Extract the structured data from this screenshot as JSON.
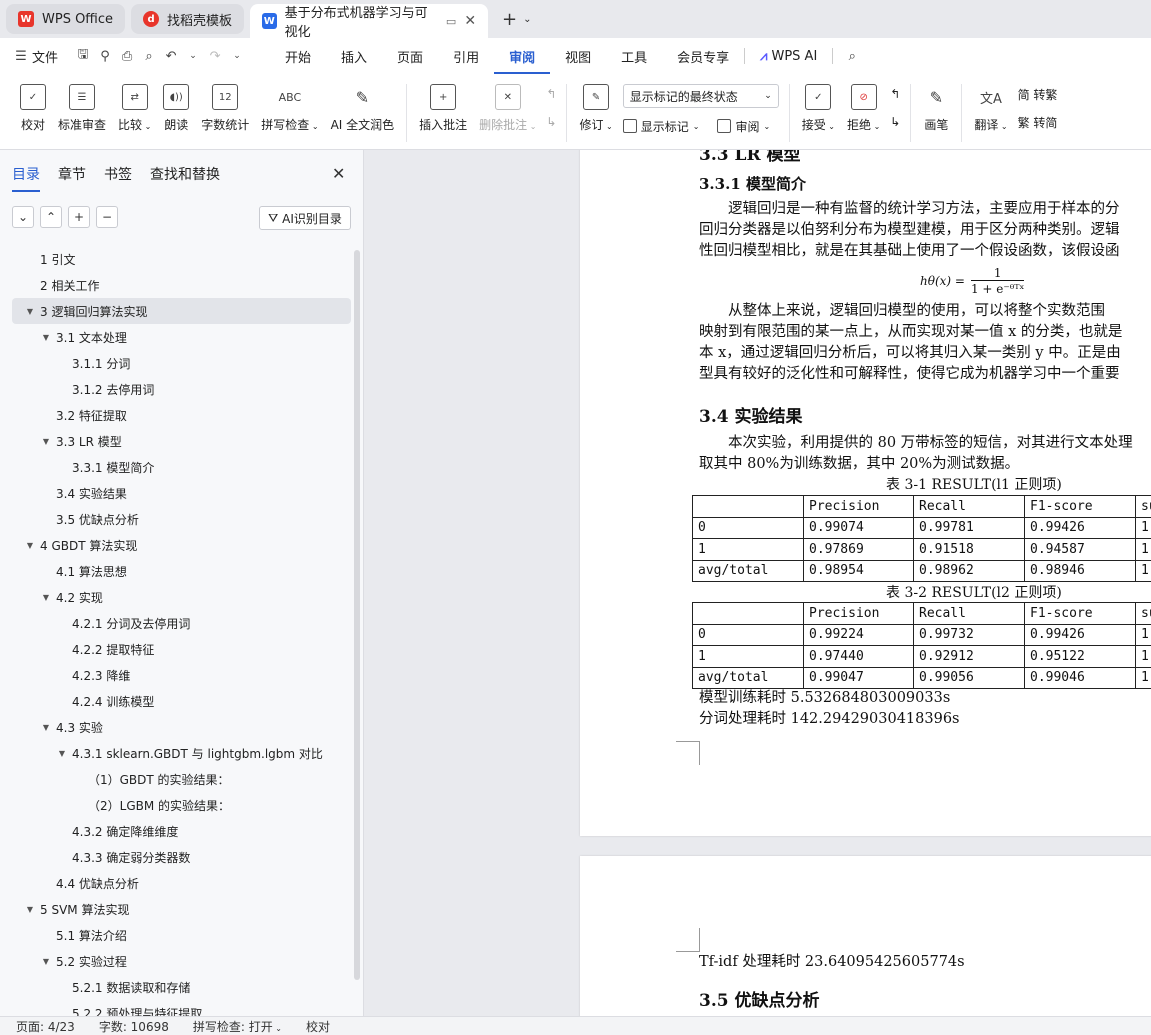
{
  "tabs": [
    {
      "label": "WPS Office",
      "icon": "wps-logo-icon"
    },
    {
      "label": "找稻壳模板",
      "icon": "docer-logo-icon"
    },
    {
      "label": "基于分布式机器学习与可视化",
      "icon": "writer-logo-icon"
    }
  ],
  "menu": {
    "file": "文件",
    "items": [
      "开始",
      "插入",
      "页面",
      "引用",
      "审阅",
      "视图",
      "工具",
      "会员专享"
    ],
    "active": "审阅",
    "wpsai": "WPS AI"
  },
  "ribbon": {
    "proof": "校对",
    "std_review": "标准审查",
    "compare": "比较",
    "read": "朗读",
    "wordcount": "字数统计",
    "spell": "拼写检查",
    "ai_polish": "AI 全文润色",
    "insert_comment": "插入批注",
    "delete_comment": "删除批注",
    "revise": "修订",
    "mark_state": "显示标记的最终状态",
    "show_marks": "显示标记",
    "review": "审阅",
    "accept": "接受",
    "reject": "拒绝",
    "pen": "画笔",
    "translate": "翻译",
    "to_traditional": "简 转繁",
    "to_simplified": "繁 转简",
    "wordcount_icon_text": "12",
    "spell_icon_text": "ABC"
  },
  "panel": {
    "tabs": [
      "目录",
      "章节",
      "书签",
      "查找和替换"
    ],
    "ai_toc": "AI识别目录",
    "toc": [
      {
        "text": "1 引文",
        "level": 0,
        "caret": ""
      },
      {
        "text": "2 相关工作",
        "level": 0,
        "caret": ""
      },
      {
        "text": "3 逻辑回归算法实现",
        "level": 0,
        "caret": "▼",
        "selected": true
      },
      {
        "text": "3.1 文本处理",
        "level": 1,
        "caret": "▼"
      },
      {
        "text": "3.1.1 分词",
        "level": 2,
        "caret": ""
      },
      {
        "text": "3.1.2 去停用词",
        "level": 2,
        "caret": ""
      },
      {
        "text": "3.2 特征提取",
        "level": 1,
        "caret": ""
      },
      {
        "text": "3.3 LR 模型",
        "level": 1,
        "caret": "▼"
      },
      {
        "text": "3.3.1 模型简介",
        "level": 2,
        "caret": ""
      },
      {
        "text": "3.4  实验结果",
        "level": 1,
        "caret": ""
      },
      {
        "text": "3.5  优缺点分析",
        "level": 1,
        "caret": ""
      },
      {
        "text": "4 GBDT 算法实现",
        "level": 0,
        "caret": "▼"
      },
      {
        "text": "4.1 算法思想",
        "level": 1,
        "caret": ""
      },
      {
        "text": "4.2 实现",
        "level": 1,
        "caret": "▼"
      },
      {
        "text": "4.2.1 分词及去停用词",
        "level": 2,
        "caret": ""
      },
      {
        "text": "4.2.2 提取特征",
        "level": 2,
        "caret": ""
      },
      {
        "text": "4.2.3 降维",
        "level": 2,
        "caret": ""
      },
      {
        "text": "4.2.4 训练模型",
        "level": 2,
        "caret": ""
      },
      {
        "text": "4.3 实验",
        "level": 1,
        "caret": "▼"
      },
      {
        "text": "4.3.1 sklearn.GBDT 与 lightgbm.lgbm 对比",
        "level": 2,
        "caret": "▼"
      },
      {
        "text": "（1）GBDT 的实验结果：",
        "level": 3,
        "caret": ""
      },
      {
        "text": "（2）LGBM 的实验结果：",
        "level": 3,
        "caret": ""
      },
      {
        "text": "4.3.2  确定降维维度",
        "level": 2,
        "caret": ""
      },
      {
        "text": "4.3.3  确定弱分类器数",
        "level": 2,
        "caret": ""
      },
      {
        "text": "4.4  优缺点分析",
        "level": 1,
        "caret": ""
      },
      {
        "text": "5   SVM 算法实现",
        "level": 0,
        "caret": "▼"
      },
      {
        "text": "5.1 算法介绍",
        "level": 1,
        "caret": ""
      },
      {
        "text": "5.2 实验过程",
        "level": 1,
        "caret": "▼"
      },
      {
        "text": "5.2.1  数据读取和存储",
        "level": 2,
        "caret": ""
      },
      {
        "text": "5.2.2  预处理与特征提取",
        "level": 2,
        "caret": ""
      }
    ]
  },
  "doc": {
    "h_33": "3.3 LR 模型",
    "h_331": "3.3.1 模型简介",
    "p1": [
      "　　逻辑回归是一种有监督的统计学习方法，主要应用于样本的分",
      "回归分类器是以伯努利分布为模型建模，用于区分两种类别。逻辑",
      "性回归模型相比，就是在其基础上使用了一个假设函数，该假设函"
    ],
    "formula_lhs": "hθ(x) =",
    "formula_num": "1",
    "formula_den": "1 + e⁻ᶿᵀˣ",
    "p2": [
      "　　从整体上来说，逻辑回归模型的使用，可以将整个实数范围",
      "映射到有限范围的某一点上，从而实现对某一值 x 的分类，也就是",
      "本 x，通过逻辑回归分析后，可以将其归入某一类别 y 中。正是由",
      "型具有较好的泛化性和可解释性，使得它成为机器学习中一个重要"
    ],
    "h_34": "3.4  实验结果",
    "p3": [
      "　　本次实验，利用提供的 80 万带标签的短信，对其进行文本处理",
      "取其中 80%为训练数据，其中 20%为测试数据。"
    ],
    "table1_caption": "表 3-1 RESULT(l1 正则项)",
    "table1": [
      [
        "",
        "Precision",
        "Recall",
        "F1-score",
        "su"
      ],
      [
        "0",
        "0.99074",
        "0.99781",
        "0.99426",
        "1"
      ],
      [
        "1",
        "0.97869",
        "0.91518",
        "0.94587",
        "1"
      ],
      [
        "avg/total",
        "0.98954",
        "0.98962",
        "0.98946",
        "1"
      ]
    ],
    "table2_caption": "表 3-2 RESULT(l2 正则项)",
    "table2": [
      [
        "",
        "Precision",
        "Recall",
        "F1-score",
        "su"
      ],
      [
        "0",
        "0.99224",
        "0.99732",
        "0.99426",
        "1"
      ],
      [
        "1",
        "0.97440",
        "0.92912",
        "0.95122",
        "1"
      ],
      [
        "avg/total",
        "0.99047",
        "0.99056",
        "0.99046",
        "1"
      ]
    ],
    "train_time": "模型训练耗时 5.532684803009033s",
    "seg_time": "分词处理耗时 142.29429030418396s",
    "tfidf_time": "Tf-idf 处理耗时  23.64095425605774s",
    "h_35": "3.5  优缺点分析"
  },
  "status": {
    "page": "页面: 4/23",
    "words": "字数: 10698",
    "spell": "拼写检查: 打开",
    "proof": "校对"
  },
  "colors": {
    "accent": "#2a5fd0",
    "wps_red": "#e8352b",
    "docer_red": "#e8352b",
    "writer_blue": "#2a6be8"
  }
}
